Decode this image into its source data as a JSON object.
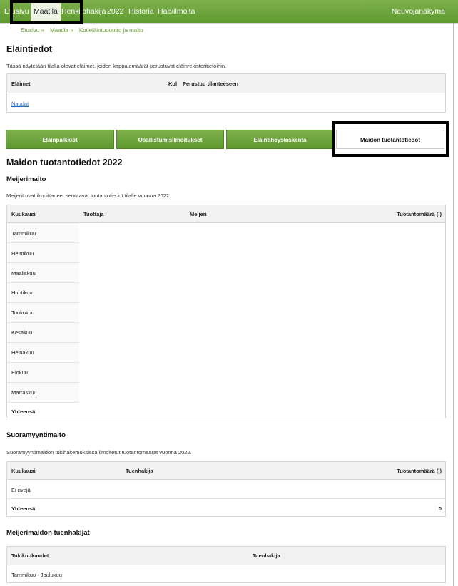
{
  "nav": {
    "items": [
      "Etusivu",
      "Maatila",
      "Henkilöhakija",
      "2022",
      "Historia",
      "Hae/ilmoita"
    ],
    "active": "Maatila",
    "right": "Neuvojanäkymä"
  },
  "breadcrumb": [
    "Etusivu »",
    "Maatila »",
    "Kotieläintuotanto ja maito"
  ],
  "elaintiedot": {
    "title": "Eläintiedot",
    "desc": "Tässä näytetään tilalla olevat eläimet, joiden kappalemäärät perustuvat eläinrekisteritietoihin.",
    "headers": [
      "Eläimet",
      "Kpl",
      "Perustuu tilanteeseen"
    ],
    "rows": [
      "Naudat"
    ]
  },
  "tabs": [
    "Eläinpalkkiot",
    "Osallistumisilmoitukset",
    "Eläintiheyslaskenta",
    "Maidon tuotantotiedot"
  ],
  "milk": {
    "title": "Maidon tuotantotiedot 2022",
    "dairy": {
      "title": "Meijerimaito",
      "desc": "Meijerit ovat ilmoittaneet seuraavat tuotantotiedot tilalle vuonna 2022.",
      "headers": [
        "Kuukausi",
        "Tuottaja",
        "Meijeri",
        "Tuotantomäärä (l)"
      ],
      "months": [
        "Tammikuu",
        "Helmikuu",
        "Maaliskuu",
        "Huhtikuu",
        "Toukokuu",
        "Kesäkuu",
        "Heinäkuu",
        "Elokuu",
        "Marraskuu"
      ],
      "total_label": "Yhteensä"
    },
    "direct": {
      "title": "Suoramyyntimaito",
      "desc": "Suoramyyntimaidon tukihakemuksissa ilmoitetut tuotantomäärät vuonna 2022.",
      "headers": [
        "Kuukausi",
        "Tuenhakija",
        "Tuotantomäärä (l)"
      ],
      "empty": "Ei rivejä",
      "total_label": "Yhteensä",
      "total_value": "0"
    },
    "applicants": {
      "title": "Meijerimaidon tuenhakijat",
      "headers": [
        "Tukikuukaudet",
        "Tuenhakija"
      ],
      "rows": [
        "Tammikuu - Joulukuu"
      ]
    }
  }
}
